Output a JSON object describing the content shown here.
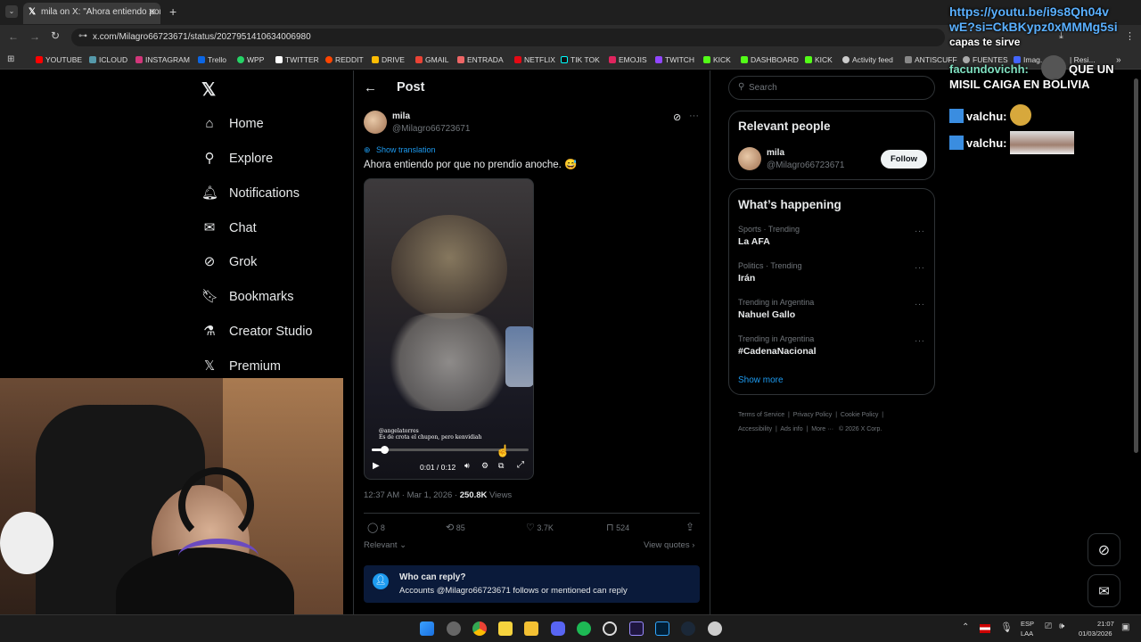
{
  "browser": {
    "tab_title": "mila on X: \"Ahora entiendo por",
    "url": "x.com/Milagro66723671/status/2027951410634006980",
    "bookmarks": [
      "YOUTUBE",
      "ICLOUD",
      "INSTAGRAM",
      "Trello",
      "WPP",
      "TWITTER",
      "REDDIT",
      "DRIVE",
      "GMAIL",
      "ENTRADA",
      "NETFLIX",
      "TIK TOK",
      "EMOJIS",
      "TWITCH",
      "KICK",
      "DASHBOARD",
      "KICK",
      "Activity feed",
      "ANTISCUFF",
      "FUENTES",
      "Imag...",
      "| Resi..."
    ]
  },
  "nav": {
    "items": [
      "Home",
      "Explore",
      "Notifications",
      "Chat",
      "Grok",
      "Bookmarks",
      "Creator Studio",
      "Premium"
    ]
  },
  "post": {
    "header": "Post",
    "author_name": "mila",
    "author_handle": "@Milagro66723671",
    "show_translation": "Show translation",
    "text": "Ahora entiendo por que no prendio anoche. 😅",
    "video_caption_1": "@angelatorres",
    "video_caption_2": "Es de crota el chupon, pero kenvidiah",
    "video_time": "0:01 / 0:12",
    "video_progress": 0.08,
    "timestamp": "12:37 AM · Mar 1, 2026 · ",
    "views_count": "250.8K",
    "views_label": " Views",
    "replies": "8",
    "reposts": "85",
    "likes": "3.7K",
    "bookmarks": "524",
    "relevant_label": "Relevant",
    "view_quotes": "View quotes",
    "who_can_reply_title": "Who can reply?",
    "who_can_reply_text": "Accounts @Milagro66723671 follows or mentioned can reply"
  },
  "sidebar": {
    "search_placeholder": "Search",
    "relevant_title": "Relevant people",
    "person_name": "mila",
    "person_handle": "@Milagro66723671",
    "follow_label": "Follow",
    "happening_title": "What’s happening",
    "trends": [
      {
        "category": "Sports · Trending",
        "name": "La AFA"
      },
      {
        "category": "Politics · Trending",
        "name": "Irán"
      },
      {
        "category": "Trending in Argentina",
        "name": "Nahuel Gallo"
      },
      {
        "category": "Trending in Argentina",
        "name": "#CadenaNacional"
      }
    ],
    "show_more": "Show more",
    "footer_links": [
      "Terms of Service",
      "Privacy Policy",
      "Cookie Policy",
      "Accessibility",
      "Ads info",
      "More ···",
      "© 2026 X Corp."
    ]
  },
  "chat": {
    "link_line1": "https://youtu.be/i9s8Qh04v",
    "link_line2": "wE?si=CkBKypz0xMMMg5si",
    "msg1": "capas te sirve",
    "user2": "facundovichh:",
    "msg2_a": "QUE UN",
    "msg2_b": "MISIL CAIGA EN BOLIVIA",
    "user3": "valchu:",
    "user4": "valchu:"
  },
  "taskbar": {
    "lang_1": "ESP",
    "lang_2": "LAA",
    "time": "21:07",
    "date": "01/03/2026"
  },
  "colors": {
    "accent": "#1d9bf0",
    "background": "#000000",
    "border": "#2f3336",
    "muted": "#71767b"
  }
}
